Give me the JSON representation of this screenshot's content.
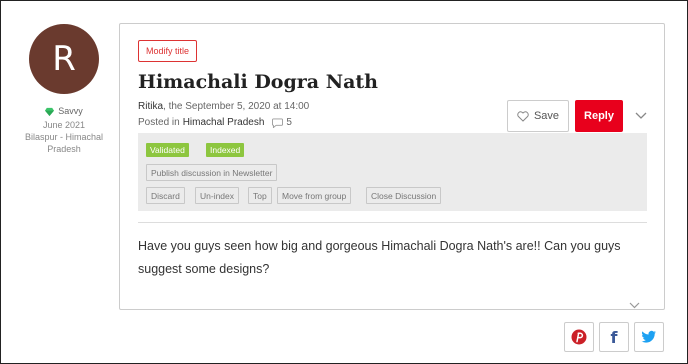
{
  "author": {
    "initial": "R",
    "rank": "Savvy",
    "joined": "June 2021",
    "location": "Bilaspur - Himachal Pradesh"
  },
  "post": {
    "modify_title_label": "Modify title",
    "title": "Himachali Dogra Nath",
    "author_name": "Ritika",
    "date_text": ", the September 5, 2020 at 14:00",
    "posted_in_label": "Posted in",
    "category": "Himachal Pradesh",
    "comment_count": "5",
    "body": "Have you guys seen how big and gorgeous Himachali Dogra Nath's are!! Can you guys suggest some designs?"
  },
  "actions": {
    "save_label": "Save",
    "reply_label": "Reply"
  },
  "moderation": {
    "badges": [
      "Validated",
      "Indexed"
    ],
    "publish_label": "Publish discussion in Newsletter",
    "discard_label": "Discard",
    "unindex_label": "Un-index",
    "top_label": "Top",
    "move_label": "Move from group",
    "close_label": "Close Discussion"
  },
  "share": {
    "pinterest": "pinterest-icon",
    "facebook": "facebook-icon",
    "twitter": "twitter-icon"
  },
  "colors": {
    "accent": "#e8001c",
    "badge_green": "#8dc63f",
    "avatar_bg": "#6a3a2e",
    "pinterest": "#cb2027",
    "facebook": "#3b5998",
    "twitter": "#1da1f2"
  }
}
